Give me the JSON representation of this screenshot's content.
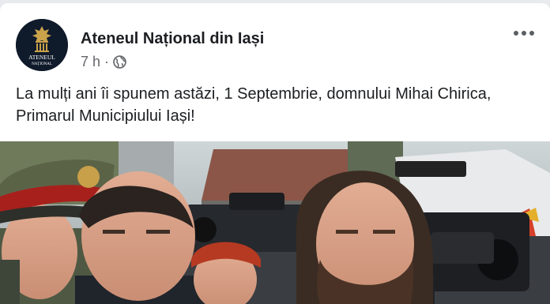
{
  "post": {
    "author": "Ateneul Național din Iași",
    "time": "7 h",
    "separator": "·",
    "audience_icon": "globe-icon",
    "more_icon": "more-options-icon",
    "text": "La mulți ani îi spunem astăzi, 1 Septembrie, domnului Mihai Chirica, Primarul Municipiului Iași!",
    "avatar_label_line1": "ATENEUL",
    "avatar_label_line2": "NAȚIONAL"
  },
  "colors": {
    "background": "#e9eaee",
    "card": "#ffffff",
    "text": "#1c1e21",
    "secondary_text": "#65676b",
    "avatar_bg": "#0f1a2b",
    "avatar_gold": "#c9a24a"
  }
}
